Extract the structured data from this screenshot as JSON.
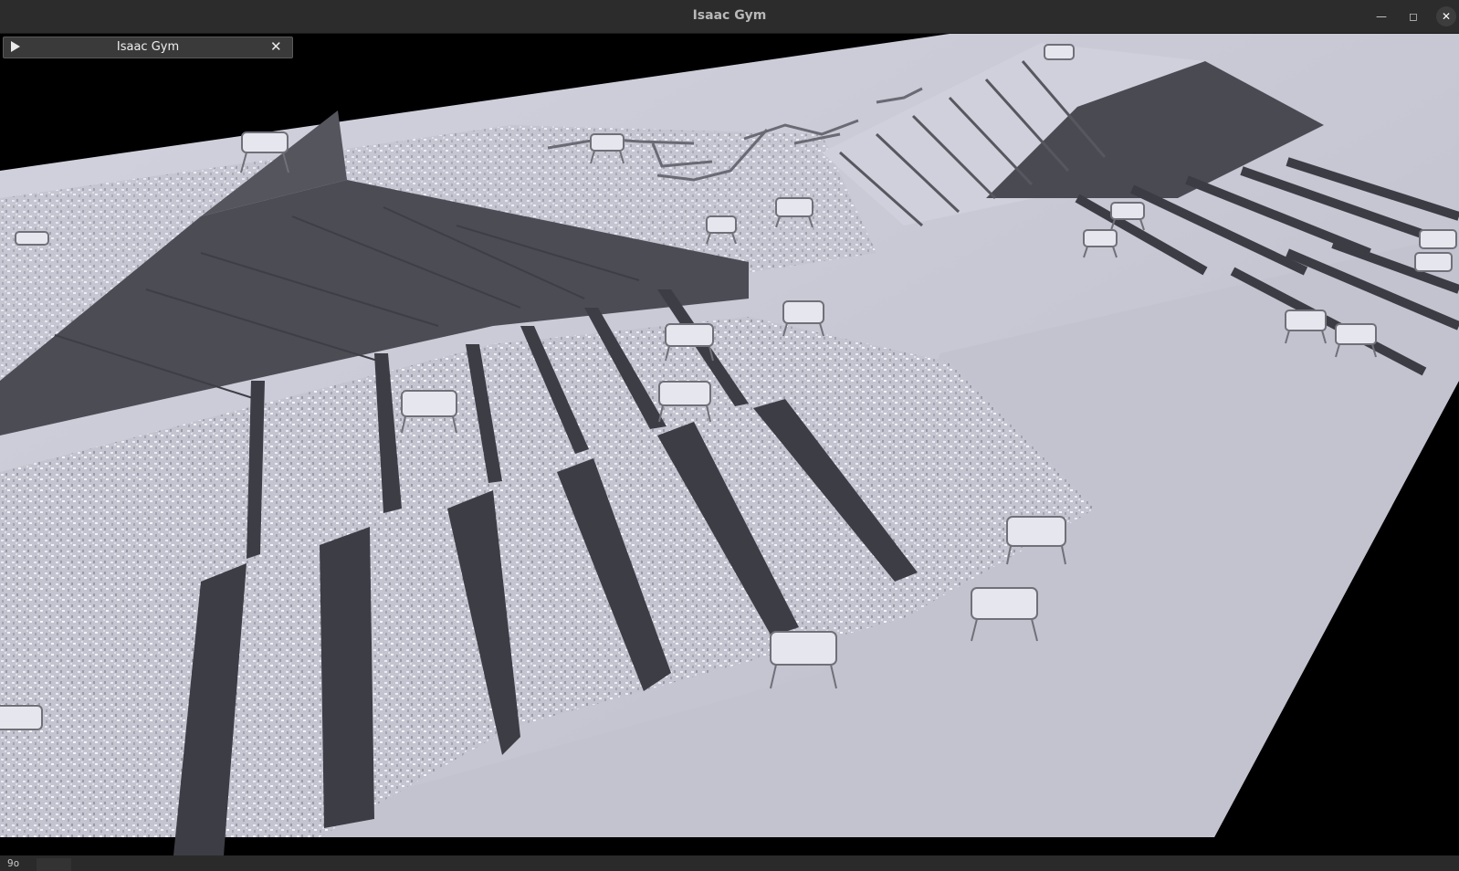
{
  "window": {
    "title": "Isaac Gym",
    "minimize_icon": "minimize-icon",
    "maximize_icon": "maximize-icon",
    "close_icon": "close-icon"
  },
  "viewer_panel": {
    "title": "Isaac Gym",
    "play_icon": "play-icon",
    "close_icon": "close-icon"
  },
  "status_bar": {
    "text": "9o"
  },
  "colors": {
    "titlebar": "#2c2c2c",
    "ground": "#c9c9d6",
    "wall_shadow": "#4a4a52",
    "panel": "#3a3a3a"
  }
}
